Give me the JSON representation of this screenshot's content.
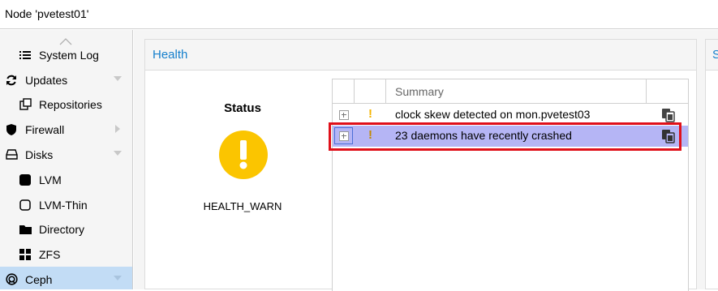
{
  "window": {
    "title": "Node 'pvetest01'"
  },
  "sidebar": {
    "items": [
      {
        "label": "System Log",
        "icon": "list-icon",
        "level": 1
      },
      {
        "label": "Updates",
        "icon": "refresh-icon",
        "level": 0,
        "expander": "collapse"
      },
      {
        "label": "Repositories",
        "icon": "repositories-icon",
        "level": 1
      },
      {
        "label": "Firewall",
        "icon": "shield-icon",
        "level": 0,
        "expander": "expand"
      },
      {
        "label": "Disks",
        "icon": "disk-icon",
        "level": 0,
        "expander": "collapse"
      },
      {
        "label": "LVM",
        "icon": "square-solid-icon",
        "level": 1
      },
      {
        "label": "LVM-Thin",
        "icon": "square-outline-icon",
        "level": 1
      },
      {
        "label": "Directory",
        "icon": "folder-icon",
        "level": 1
      },
      {
        "label": "ZFS",
        "icon": "grid-icon",
        "level": 1
      },
      {
        "label": "Ceph",
        "icon": "ceph-icon",
        "level": 0,
        "expander": "collapse",
        "selected": true
      }
    ]
  },
  "health_panel": {
    "title": "Health",
    "status": {
      "heading": "Status",
      "value": "HEALTH_WARN",
      "icon": "warning-circle-icon",
      "color": "#fbc500"
    },
    "grid": {
      "columns": [
        "",
        "",
        "Summary",
        ""
      ],
      "rows": [
        {
          "severity": "!",
          "summary": "clock skew detected on mon.pvetest03",
          "selected": false
        },
        {
          "severity": "!",
          "summary": "23 daemons have recently crashed",
          "selected": true
        }
      ]
    }
  },
  "second_panel": {
    "title": "S"
  },
  "colors": {
    "accent": "#157fcc",
    "selected_row": "#b5b5f5",
    "highlight": "#e0101a",
    "warning": "#fbc500"
  }
}
